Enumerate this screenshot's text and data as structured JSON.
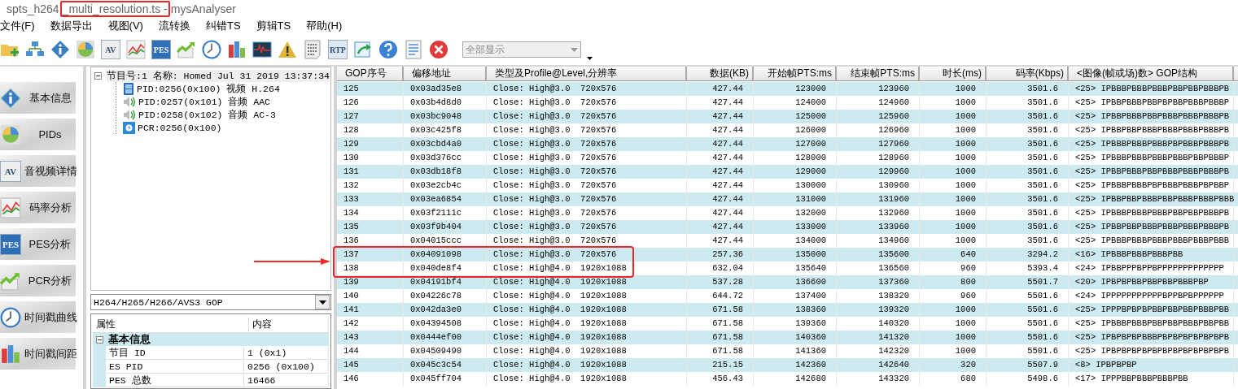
{
  "window": {
    "title_parts": [
      {
        "text": "spts_h264",
        "marked": false
      },
      {
        "text": "_multi_resolution.ts -",
        "marked": true
      },
      {
        "text": "mysAnalyser",
        "marked": false
      }
    ]
  },
  "menu": [
    "文件(F)",
    "数据导出",
    "视图(V)",
    "流转换",
    "纠错TS",
    "剪辑TS",
    "帮助(H)"
  ],
  "toolbar": {
    "buttons": [
      {
        "kind": "folder-add"
      },
      {
        "kind": "network"
      },
      {
        "kind": "info"
      },
      {
        "kind": "pie"
      },
      {
        "kind": "av",
        "label": "AV"
      },
      {
        "kind": "line-chart"
      },
      {
        "kind": "pes",
        "label": "PES"
      },
      {
        "kind": "trend"
      },
      {
        "kind": "clock"
      },
      {
        "kind": "bars"
      },
      {
        "kind": "waveform"
      },
      {
        "kind": "warning"
      },
      {
        "kind": "binary"
      },
      {
        "kind": "rtp",
        "label": "RTP"
      },
      {
        "kind": "export"
      },
      {
        "kind": "help"
      },
      {
        "kind": "document"
      },
      {
        "kind": "stop"
      }
    ],
    "filter": {
      "value": "全部显示",
      "disabled": true
    }
  },
  "sidebar": {
    "buttons": [
      {
        "kind": "info",
        "label": "基本信息"
      },
      {
        "kind": "pie",
        "label": "PIDs"
      },
      {
        "kind": "av",
        "label": "音视频详情",
        "icon_text": "AV"
      },
      {
        "kind": "line-chart",
        "label": "码率分析"
      },
      {
        "kind": "pes",
        "label": "PES分析",
        "icon_text": "PES"
      },
      {
        "kind": "trend",
        "label": "PCR分析"
      },
      {
        "kind": "clock",
        "label": "时间戳曲线"
      },
      {
        "kind": "bars",
        "label": "时间戳间距"
      }
    ]
  },
  "tree": {
    "root": {
      "kind": "program",
      "label": "节目号:1 名称: Homed Jul 31 2019 13:37:34",
      "expanded": true,
      "children": [
        {
          "kind": "video",
          "label": "PID:0256(0x100) 视频 H.264"
        },
        {
          "kind": "audio",
          "label": "PID:0257(0x101) 音频 AAC"
        },
        {
          "kind": "audio",
          "label": "PID:0258(0x102) 音频 AC-3"
        },
        {
          "kind": "pcr",
          "label": "PCR:0256(0x100)"
        }
      ]
    }
  },
  "view_select": {
    "value": "H264/H265/H266/AVS3 GOP"
  },
  "properties": {
    "columns": [
      "属性",
      "内容"
    ],
    "groups": [
      {
        "label": "基本信息",
        "expanded": true,
        "rows": [
          {
            "name": "节目 ID",
            "value": "1 (0x1)"
          },
          {
            "name": "ES PID",
            "value": "0256 (0x100)"
          },
          {
            "name": "PES 总数",
            "value": "16466"
          }
        ]
      }
    ]
  },
  "table": {
    "columns": [
      "GOP序号",
      "偏移地址",
      "类型及Profile@Level,分辨率",
      "数据(KB)",
      "开始帧PTS:ms",
      "结束帧PTS:ms",
      "时长(ms)",
      "码率(Kbps)",
      "<图像(帧或场)数> GOP结构"
    ],
    "rows": [
      {
        "marked": false,
        "cells": [
          "125",
          "0x03ad35e8",
          "Close: High@3.0  720x576",
          "427.44",
          "123000",
          "123960",
          "1000",
          "3501.6",
          "<25> IPBBBPBBBPBBBPBBPBBPBBBPB"
        ]
      },
      {
        "marked": false,
        "cells": [
          "126",
          "0x03b4d8d0",
          "Close: High@3.0  720x576",
          "427.44",
          "124000",
          "124960",
          "1000",
          "3501.6",
          "<25> IPBBPBBBPBBPBPBBPBBBPBBBP"
        ]
      },
      {
        "marked": false,
        "cells": [
          "127",
          "0x03bc9048",
          "Close: High@3.0  720x576",
          "427.44",
          "125000",
          "125960",
          "1000",
          "3501.6",
          "<25> IPBBPBBBPBBPBBBPBBBPBBBPB"
        ]
      },
      {
        "marked": false,
        "cells": [
          "128",
          "0x03c425f8",
          "Close: High@3.0  720x576",
          "427.44",
          "126000",
          "126960",
          "1000",
          "3501.6",
          "<25> IPBBPBBPBBBPBBBPBBBPBBBPB"
        ]
      },
      {
        "marked": false,
        "cells": [
          "129",
          "0x03cbd4a0",
          "Close: High@3.0  720x576",
          "427.44",
          "127000",
          "127960",
          "1000",
          "3501.6",
          "<25> IPBBBPBBBPBBBPBPBBBPBBBPB"
        ]
      },
      {
        "marked": false,
        "cells": [
          "130",
          "0x03d376cc",
          "Close: High@3.0  720x576",
          "427.44",
          "128000",
          "128960",
          "1000",
          "3501.6",
          "<25> IPBBBPBBBPBBBPBBBPBBPBBBP"
        ]
      },
      {
        "marked": false,
        "cells": [
          "131",
          "0x03db18f8",
          "Close: High@3.0  720x576",
          "427.44",
          "129000",
          "129960",
          "1000",
          "3501.6",
          "<25> IPBBPBBBPBBPBBBPBBBPBBBPB"
        ]
      },
      {
        "marked": false,
        "cells": [
          "132",
          "0x03e2cb4c",
          "Close: High@3.0  720x576",
          "427.44",
          "130000",
          "130960",
          "1000",
          "3501.6",
          "<25> IPBBBPBBBPBPBBBPBBBPBPBBP"
        ]
      },
      {
        "marked": false,
        "cells": [
          "133",
          "0x03ea6854",
          "Close: High@3.0  720x576",
          "427.44",
          "131000",
          "131960",
          "1000",
          "3501.6",
          "<25> IPBBPBBPBBBPBBPBBBPBBBPBBB"
        ]
      },
      {
        "marked": false,
        "cells": [
          "134",
          "0x03f2111c",
          "Close: High@3.0  720x576",
          "427.44",
          "132000",
          "132960",
          "1000",
          "3501.6",
          "<25> IPBBBPBBBPBBBPBBPBBPBBBPB"
        ]
      },
      {
        "marked": false,
        "cells": [
          "135",
          "0x03f9b404",
          "Close: High@3.0  720x576",
          "427.44",
          "133000",
          "133960",
          "1000",
          "3501.6",
          "<25> IPBBPBBPBBBPBBBPBBBPBBBPB"
        ]
      },
      {
        "marked": false,
        "cells": [
          "136",
          "0x04015ccc",
          "Close: High@3.0  720x576",
          "427.44",
          "134000",
          "134960",
          "1000",
          "3501.6",
          "<25> IPBBBPBBBPBBBPBBBPBBBPBBB"
        ]
      },
      {
        "marked": true,
        "cells": [
          "137",
          "0x04091098",
          "Close: High@3.0  720x576",
          "257.36",
          "135000",
          "135600",
          "640",
          "3294.2",
          "<16> IPBBBPBBBPBBBPBB"
        ]
      },
      {
        "marked": true,
        "cells": [
          "138",
          "0x040de8f4",
          "Close: High@4.0  1920x1088",
          "632.04",
          "135640",
          "136560",
          "960",
          "5393.4",
          "<24> IPBBPPPBPPBPPPPPPPPPPPPP"
        ]
      },
      {
        "marked": false,
        "cells": [
          "139",
          "0x04191bf4",
          "Close: High@4.0  1920x1088",
          "537.28",
          "136600",
          "137360",
          "800",
          "5501.7",
          "<20> IPBPBPBBPBBPBBPBBBPBP"
        ]
      },
      {
        "marked": false,
        "cells": [
          "140",
          "0x04226c78",
          "Close: High@4.0  1920x1088",
          "644.72",
          "137400",
          "138320",
          "960",
          "5501.6",
          "<24> IPPPPPPPPPPPBPPBPBPPPPPP"
        ]
      },
      {
        "marked": false,
        "cells": [
          "141",
          "0x042da3e0",
          "Close: High@4.0  1920x1088",
          "671.58",
          "138360",
          "139320",
          "1000",
          "5501.6",
          "<25> IPPPBPBPBPBBPBBPBBPBBBPBB"
        ]
      },
      {
        "marked": false,
        "cells": [
          "142",
          "0x04394508",
          "Close: High@4.0  1920x1088",
          "671.58",
          "139360",
          "140320",
          "1000",
          "5501.6",
          "<25> IPBBBPBBBPBBPBBPBBBPBBPBB"
        ]
      },
      {
        "marked": false,
        "cells": [
          "143",
          "0x0444ef00",
          "Close: High@4.0  1920x1088",
          "671.58",
          "140360",
          "141320",
          "1000",
          "5501.6",
          "<25> IPBPBPBPBBBPBPBPBPBPBPBPB"
        ]
      },
      {
        "marked": false,
        "cells": [
          "144",
          "0x04509490",
          "Close: High@4.0  1920x1088",
          "671.58",
          "141360",
          "142320",
          "1000",
          "5501.6",
          "<25> IPBPBPBPBPBPBPBPBPBPBPBPB"
        ]
      },
      {
        "marked": false,
        "cells": [
          "145",
          "0x045c3c54",
          "Close: High@4.0  1920x1088",
          "215.15",
          "142360",
          "142640",
          "320",
          "5507.9",
          "<8> IPBPBPBP"
        ]
      },
      {
        "marked": false,
        "cells": [
          "146",
          "0x045ff704",
          "Close: High@4.0  1920x1088",
          "456.43",
          "142680",
          "143320",
          "680",
          "5498.6",
          "<17> IPPPBBPBBBPBBBPBB"
        ]
      }
    ]
  }
}
